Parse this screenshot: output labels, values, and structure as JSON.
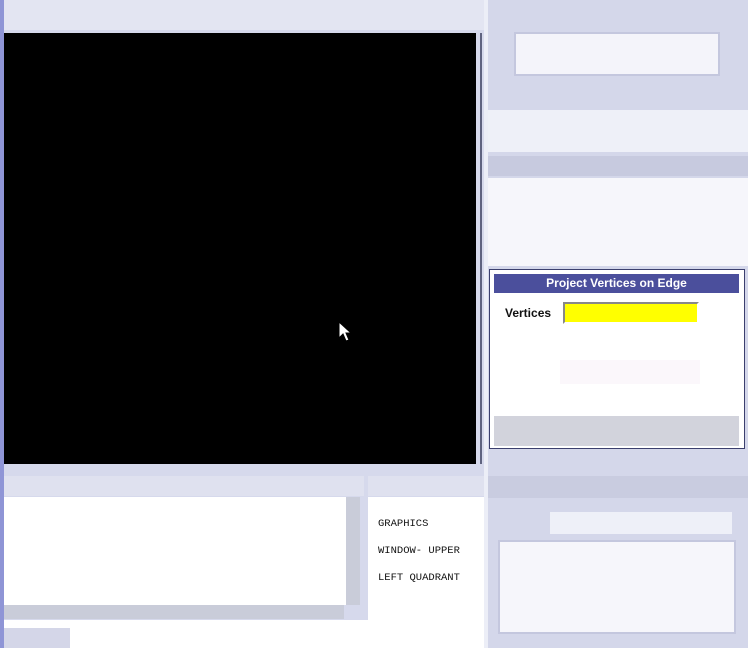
{
  "graphics_window": {
    "annotation_lines": [
      "GRAPHICS",
      "WINDOW- UPPER",
      "LEFT QUADRANT"
    ]
  },
  "dialog": {
    "title": "Project Vertices on Edge",
    "vertices_label": "Vertices",
    "vertices_value": ""
  },
  "colors": {
    "graphics_background": "#000000",
    "dialog_title_bar": "#4b4f9c",
    "vertices_field": "#ffff00"
  },
  "icons": {
    "cursor": "mouse-pointer-icon"
  }
}
